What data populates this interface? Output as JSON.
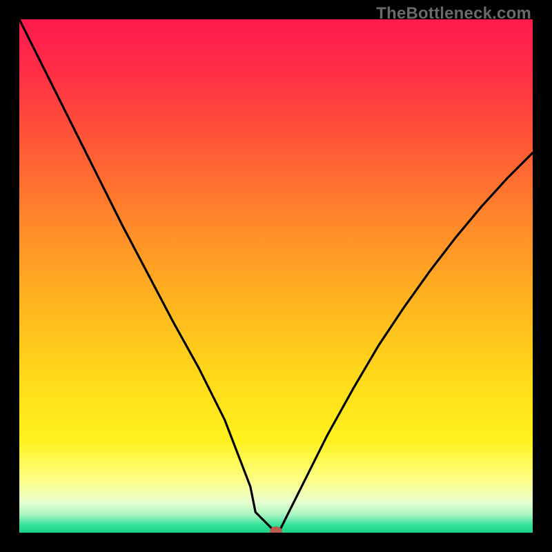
{
  "watermark": "TheBottleneck.com",
  "chart_data": {
    "type": "line",
    "title": "",
    "xlabel": "",
    "ylabel": "",
    "xlim": [
      0,
      100
    ],
    "ylim": [
      0,
      100
    ],
    "grid": false,
    "legend": false,
    "series": [
      {
        "name": "curve",
        "x": [
          0,
          5,
          10,
          15,
          20,
          25,
          30,
          35,
          40,
          45,
          46,
          50,
          50.5,
          51,
          55,
          60,
          65,
          70,
          75,
          80,
          85,
          90,
          95,
          100
        ],
        "values": [
          100,
          90,
          80,
          70,
          60,
          50.5,
          41,
          32,
          22,
          9,
          4,
          0,
          0,
          1,
          9,
          19,
          28,
          36.5,
          44,
          51,
          57.5,
          63.5,
          69,
          74
        ]
      }
    ],
    "marker": {
      "x": 50,
      "y": 0,
      "color": "#bb5a50",
      "rx": 9,
      "ry": 7
    },
    "gradient_stops": [
      {
        "offset": 0.0,
        "color": "#ff1a4e"
      },
      {
        "offset": 0.1,
        "color": "#ff2e46"
      },
      {
        "offset": 0.25,
        "color": "#ff5a36"
      },
      {
        "offset": 0.4,
        "color": "#ff8a2a"
      },
      {
        "offset": 0.55,
        "color": "#ffb41f"
      },
      {
        "offset": 0.7,
        "color": "#ffda1a"
      },
      {
        "offset": 0.82,
        "color": "#fff21e"
      },
      {
        "offset": 0.9,
        "color": "#fdff8a"
      },
      {
        "offset": 0.94,
        "color": "#e8ffd0"
      },
      {
        "offset": 0.965,
        "color": "#a8f5c0"
      },
      {
        "offset": 0.985,
        "color": "#34e29b"
      },
      {
        "offset": 1.0,
        "color": "#1ad184"
      }
    ]
  }
}
